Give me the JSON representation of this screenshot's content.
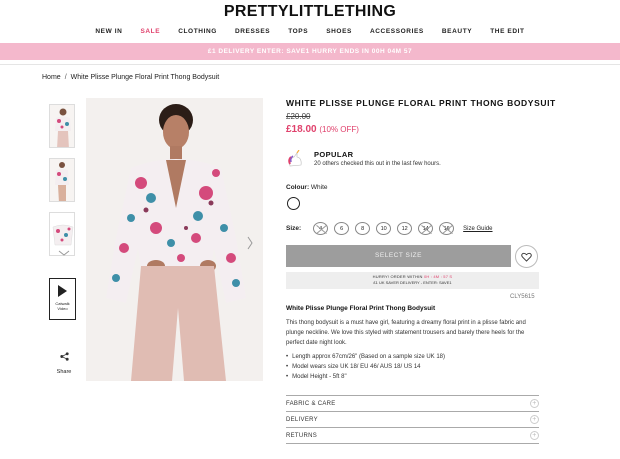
{
  "header": {
    "logo": "PRETTYLITTLETHING",
    "nav": [
      {
        "label": "NEW IN"
      },
      {
        "label": "SALE"
      },
      {
        "label": "CLOTHING"
      },
      {
        "label": "DRESSES"
      },
      {
        "label": "TOPS"
      },
      {
        "label": "SHOES"
      },
      {
        "label": "ACCESSORIES"
      },
      {
        "label": "BEAUTY"
      },
      {
        "label": "THE EDIT"
      }
    ],
    "promo": "£1 DELIVERY ENTER: SAVE1 HURRY ENDS IN 00H 04M 57"
  },
  "breadcrumb": {
    "home": "Home",
    "separator": "/",
    "current": "White Plisse Plunge Floral Print Thong Bodysuit"
  },
  "gallery": {
    "video_label": "Catwalk Video",
    "share_label": "Share"
  },
  "product": {
    "title": "WHITE PLISSE PLUNGE FLORAL PRINT THONG BODYSUIT",
    "was_price": "£20.00",
    "now_price": "£18.00",
    "discount": "(10% OFF)",
    "popular_title": "POPULAR",
    "popular_sub": "20 others checked this out in the last few hours.",
    "colour_label": "Colour:",
    "colour_value": "White",
    "size_label": "Size:",
    "sizes": [
      {
        "label": "4",
        "available": false
      },
      {
        "label": "6",
        "available": true
      },
      {
        "label": "8",
        "available": true
      },
      {
        "label": "10",
        "available": true
      },
      {
        "label": "12",
        "available": true
      },
      {
        "label": "14",
        "available": false
      },
      {
        "label": "16",
        "available": false
      }
    ],
    "size_guide": "Size Guide",
    "select_size": "SELECT SIZE",
    "hurry_line1_a": "HURRY! ORDER WITHIN",
    "hurry_timer": "0H : 4M : 57 S",
    "hurry_line2": "£1 UK SAVER DELIVERY - ENTER: SAVE1",
    "sku": "CLY5615",
    "desc_title": "White Plisse Plunge Floral Print Thong Bodysuit",
    "desc_body": "This thong bodysuit is a must have girl, featuring a dreamy floral print in a plisse fabric and plunge neckline. We love this styled with statement trousers and barely there heels for the perfect date night look.",
    "bullets": [
      "Length approx 67cm/26\" (Based on a sample size UK 18)",
      "Model wears size UK 18/ EU 46/ AUS 18/ US 14",
      "Model Height - 5ft 8\""
    ],
    "accordion": [
      {
        "label": "FABRIC & CARE"
      },
      {
        "label": "DELIVERY"
      },
      {
        "label": "RETURNS"
      }
    ]
  },
  "colors": {
    "accent": "#e0416c",
    "promo_bg": "#f4b8cc",
    "button_disabled": "#9d9d9d"
  },
  "icons": {
    "play": "play-icon",
    "share": "share-icon",
    "heart": "heart-icon",
    "unicorn": "unicorn-icon",
    "plus": "plus-icon",
    "chevron": "chevron-down-icon",
    "next": "chevron-right-icon"
  }
}
